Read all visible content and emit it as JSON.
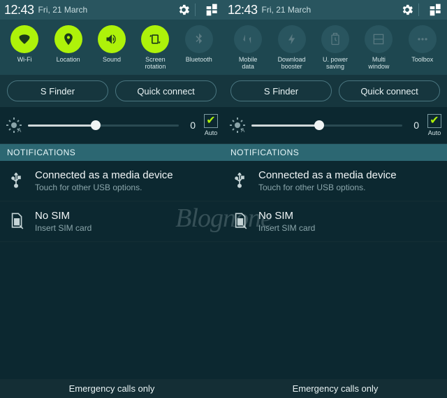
{
  "status": {
    "time": "12:43",
    "date": "Fri, 21 March"
  },
  "toggles_left": [
    {
      "name": "wifi",
      "label": "Wi-Fi",
      "active": true
    },
    {
      "name": "location",
      "label": "Location",
      "active": true
    },
    {
      "name": "sound",
      "label": "Sound",
      "active": true
    },
    {
      "name": "rotation",
      "label": "Screen\nrotation",
      "active": true
    },
    {
      "name": "bluetooth",
      "label": "Bluetooth",
      "active": false
    }
  ],
  "toggles_right": [
    {
      "name": "mobiledata",
      "label": "Mobile\ndata",
      "active": false
    },
    {
      "name": "download",
      "label": "Download\nbooster",
      "active": false
    },
    {
      "name": "powersaving",
      "label": "U. power\nsaving",
      "active": false
    },
    {
      "name": "multiwindow",
      "label": "Multi\nwindow",
      "active": false
    },
    {
      "name": "toolbox",
      "label": "Toolbox",
      "active": false
    }
  ],
  "finder": {
    "sfinder": "S Finder",
    "quickconnect": "Quick connect"
  },
  "brightness": {
    "value": "0",
    "auto_label": "Auto"
  },
  "notifications": {
    "header": "NOTIFICATIONS",
    "items": [
      {
        "icon": "usb",
        "title": "Connected as a media device",
        "sub": "Touch for other USB options."
      },
      {
        "icon": "nosim",
        "title": "No SIM",
        "sub": "Insert SIM card"
      }
    ]
  },
  "footer": "Emergency calls only",
  "watermark": "Blognone",
  "colors": {
    "accent": "#aef20a",
    "bg_dark": "#0c2830",
    "bg_header": "#29555f"
  }
}
